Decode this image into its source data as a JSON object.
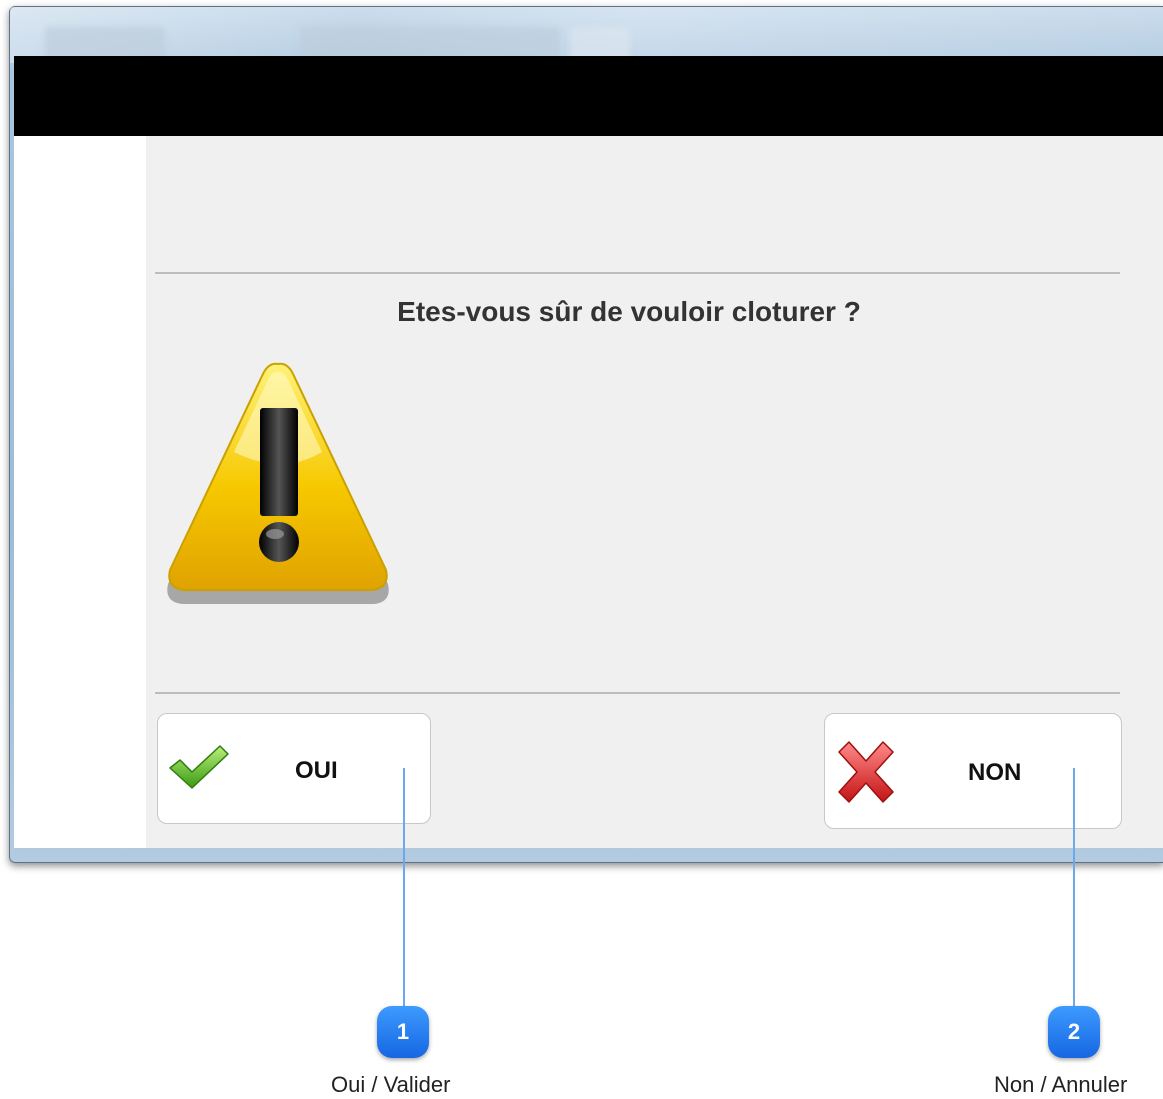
{
  "dialog": {
    "question": "Etes-vous sûr de vouloir cloturer ?",
    "icon": "warning-icon",
    "buttons": {
      "yes": {
        "label": "OUI",
        "icon": "checkmark-icon",
        "icon_color": "#4caf22"
      },
      "no": {
        "label": "NON",
        "icon": "cross-icon",
        "icon_color": "#e53030"
      }
    }
  },
  "callouts": [
    {
      "number": "1",
      "text": "Oui / Valider"
    },
    {
      "number": "2",
      "text": "Non / Annuler"
    }
  ],
  "colors": {
    "title_bar": "#000000",
    "dialog_background": "#f0f0f0",
    "warning_yellow": "#f6c800",
    "callout_blue": "#1f7af0"
  }
}
